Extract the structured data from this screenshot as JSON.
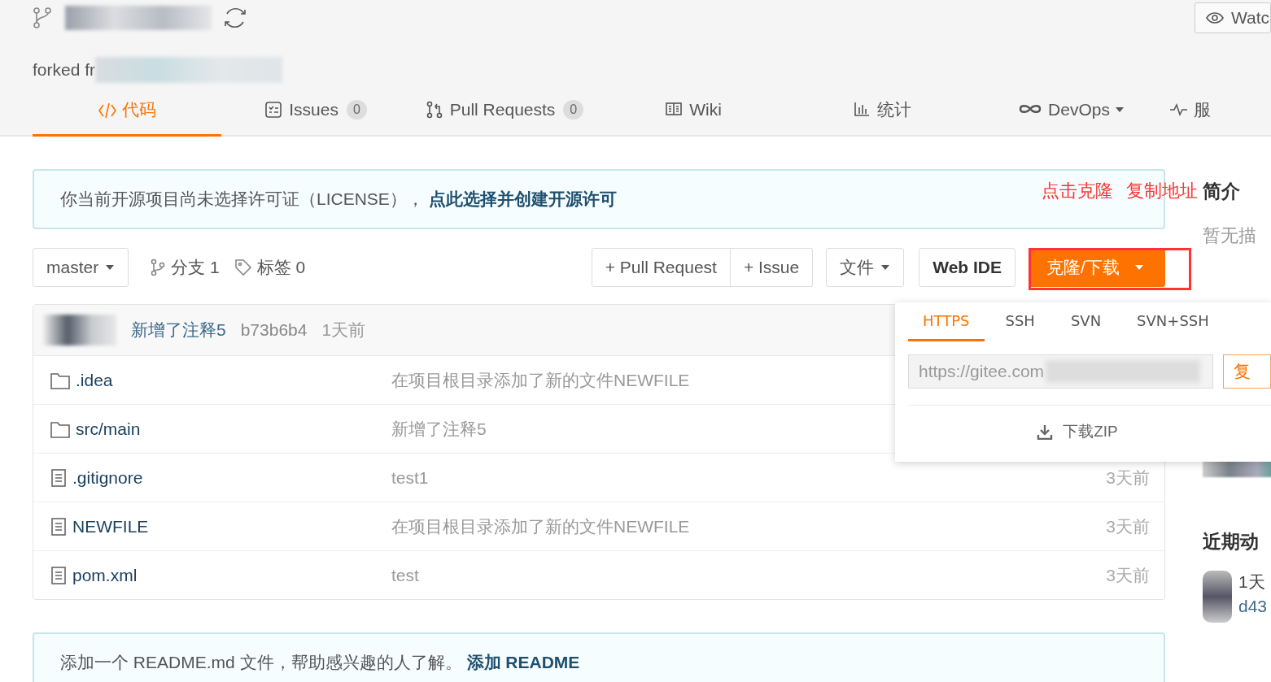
{
  "repo": {
    "forked_label": "forked fr"
  },
  "watch_button": "Watc",
  "tabs": [
    {
      "label": "代码",
      "selected": true
    },
    {
      "label": "Issues",
      "count": "0",
      "selected": false
    },
    {
      "label": "Pull Requests",
      "count": "0",
      "selected": false
    },
    {
      "label": "Wiki",
      "selected": false
    },
    {
      "label": "统计",
      "selected": false
    },
    {
      "label": "DevOps",
      "dropdown": true,
      "selected": false
    },
    {
      "label": "服",
      "selected": false
    }
  ],
  "license_notice": {
    "text": "你当前开源项目尚未选择许可证（LICENSE），",
    "link": "点此选择并创建开源许可"
  },
  "annotation": [
    "点击克隆",
    "复制地址"
  ],
  "toolbar": {
    "branch": "master",
    "branches": "分支 1",
    "tags": "标签 0",
    "new_pr": "+ Pull Request",
    "new_issue": "+ Issue",
    "file_menu": "文件",
    "web_ide": "Web IDE",
    "clone": "克隆/下载"
  },
  "last_commit": {
    "message": "新增了注释5",
    "hash": "b73b6b4",
    "time": "1天前"
  },
  "files": [
    {
      "kind": "folder",
      "name": ".idea",
      "message": "在项目根目录添加了新的文件NEWFILE"
    },
    {
      "kind": "folder",
      "name": "src/main",
      "message": "新增了注释5"
    },
    {
      "kind": "file",
      "name": ".gitignore",
      "message": "test1",
      "time": "3天前"
    },
    {
      "kind": "file",
      "name": "NEWFILE",
      "message": "在项目根目录添加了新的文件NEWFILE",
      "time": "3天前"
    },
    {
      "kind": "file",
      "name": "pom.xml",
      "message": "test",
      "time": "3天前"
    }
  ],
  "clone_menu": {
    "tabs": [
      {
        "label": "HTTPS",
        "selected": true
      },
      {
        "label": "SSH",
        "selected": false
      },
      {
        "label": "SVN",
        "selected": false
      },
      {
        "label": "SVN+SSH",
        "selected": false
      }
    ],
    "url": "https://gitee.com",
    "copy_button": "复",
    "download": "下载ZIP"
  },
  "readme_notice": {
    "text": "添加一个 README.md 文件，帮助感兴趣的人了解。",
    "link": "添加 README"
  },
  "sidebar": {
    "intro_title": "简介",
    "intro_text": "暂无描",
    "activity_title": "近期动",
    "activity": [
      {
        "time": "1天",
        "ref": "d43"
      }
    ]
  }
}
